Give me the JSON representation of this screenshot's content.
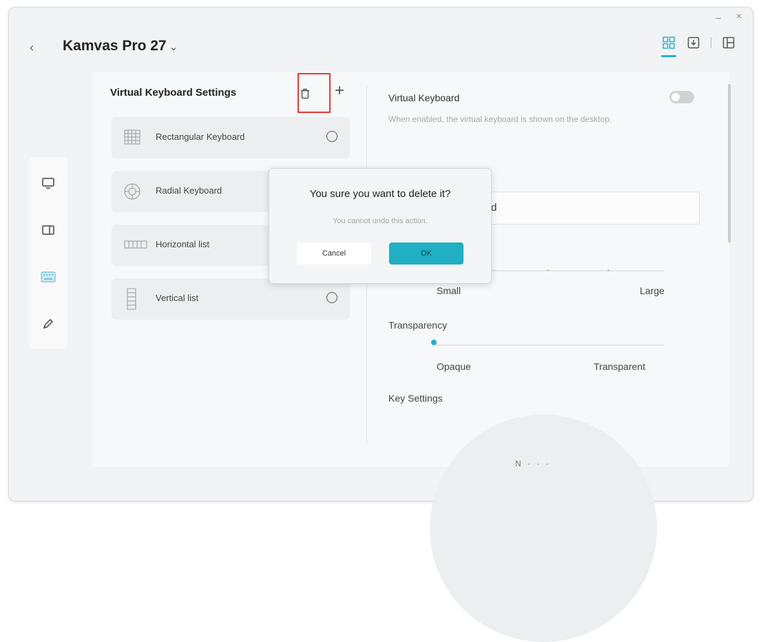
{
  "window": {
    "device_name": "Kamvas Pro 27",
    "back_icon": "chevron-left-icon",
    "minimize_label": "–",
    "close_label": "×"
  },
  "top_toolbar": {
    "icons": [
      "grid-view-icon",
      "download-icon",
      "pages-icon"
    ],
    "active_index": 0,
    "accent_color": "#1fb4c9"
  },
  "left_nav": {
    "items": [
      "monitor-icon",
      "tablet-icon",
      "keyboard-icon",
      "pen-icon"
    ],
    "active_index": 2
  },
  "keyboard_panel": {
    "title": "Virtual Keyboard Settings",
    "items": [
      {
        "label": "Rectangular Keyboard",
        "icon": "grid-keyboard-icon"
      },
      {
        "label": "Radial Keyboard",
        "icon": "radial-keyboard-icon"
      },
      {
        "label": "Horizontal list",
        "icon": "horizontal-list-icon"
      },
      {
        "label": "Vertical list",
        "icon": "vertical-list-icon"
      }
    ]
  },
  "right_panel": {
    "title": "Virtual Keyboard",
    "toggle_on": false,
    "description": "When enabled, the virtual keyboard is shown on the desktop.",
    "name_fragment": "d",
    "size": {
      "min_label": "Small",
      "max_label": "Large"
    },
    "transparency": {
      "title": "Transparency",
      "min_label": "Opaque",
      "max_label": "Transparent",
      "value": 0
    },
    "key_settings_title": "Key Settings",
    "preview_text": "N · · ·"
  },
  "dialog": {
    "title": "You sure you want to delete it?",
    "subtitle": "You cannot undo this action.",
    "cancel_label": "Cancel",
    "ok_label": "OK",
    "ok_color": "#21afc4"
  }
}
